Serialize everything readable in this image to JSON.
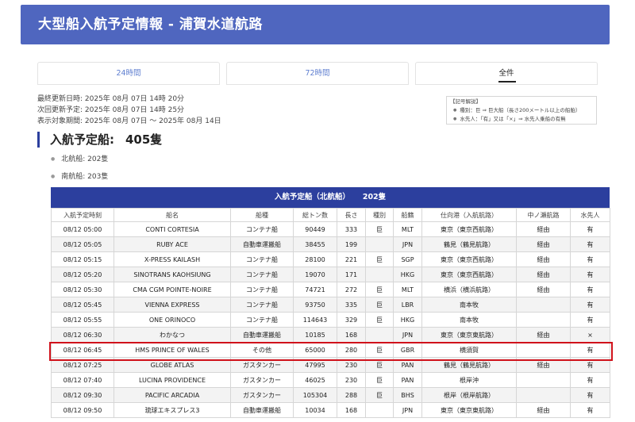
{
  "header": {
    "title": "大型船入航予定情報 - 浦賀水道航路"
  },
  "tabs": [
    {
      "label": "24時間"
    },
    {
      "label": "72時間"
    },
    {
      "label": "全件"
    }
  ],
  "meta": {
    "last_updated": "最終更新日時: 2025年 08月 07日 14時 20分",
    "next_update": "次回更新予定: 2025年 08月 07日 14時 25分",
    "period": "表示対象期間: 2025年 08月 07日 ～ 2025年 08月 14日"
  },
  "legend": {
    "title": "【記号解説】",
    "line1": "種別：巨 ⇒ 巨大船（長さ200メートル以上の船舶）",
    "line2": "水先人：「有」又は「×」⇒ 水先人乗船の有無"
  },
  "section": {
    "title": "入航予定船:",
    "count": "405隻"
  },
  "counts": {
    "north": "北航船: 202隻",
    "south": "南航船: 203隻"
  },
  "table": {
    "title": "入航予定船（北航船）",
    "count": "202隻",
    "headers": [
      "入航予定時刻",
      "船名",
      "船種",
      "総トン数",
      "長さ",
      "種別",
      "船籍",
      "仕向港（入航航路）",
      "中ノ瀬航路",
      "水先人"
    ],
    "rows": [
      [
        "08/12 05:00",
        "CONTI CORTESIA",
        "コンテナ船",
        "90449",
        "333",
        "巨",
        "MLT",
        "東京（東京西航路）",
        "経由",
        "有"
      ],
      [
        "08/12 05:05",
        "RUBY ACE",
        "自動車運搬船",
        "38455",
        "199",
        "",
        "JPN",
        "鶴見（鶴見航路）",
        "経由",
        "有"
      ],
      [
        "08/12 05:15",
        "X-PRESS KAILASH",
        "コンテナ船",
        "28100",
        "221",
        "巨",
        "SGP",
        "東京（東京西航路）",
        "経由",
        "有"
      ],
      [
        "08/12 05:20",
        "SINOTRANS KAOHSIUNG",
        "コンテナ船",
        "19070",
        "171",
        "",
        "HKG",
        "東京（東京西航路）",
        "経由",
        "有"
      ],
      [
        "08/12 05:30",
        "CMA CGM POINTE-NOIRE",
        "コンテナ船",
        "74721",
        "272",
        "巨",
        "MLT",
        "横浜（横浜航路）",
        "経由",
        "有"
      ],
      [
        "08/12 05:45",
        "VIENNA EXPRESS",
        "コンテナ船",
        "93750",
        "335",
        "巨",
        "LBR",
        "南本牧",
        "",
        "有"
      ],
      [
        "08/12 05:55",
        "ONE ORINOCO",
        "コンテナ船",
        "114643",
        "329",
        "巨",
        "HKG",
        "南本牧",
        "",
        "有"
      ],
      [
        "08/12 06:30",
        "わかなつ",
        "自動車運搬船",
        "10185",
        "168",
        "",
        "JPN",
        "東京（東京東航路）",
        "経由",
        "×"
      ],
      [
        "08/12 06:45",
        "HMS PRINCE OF WALES",
        "その他",
        "65000",
        "280",
        "巨",
        "GBR",
        "横須賀",
        "",
        "有"
      ],
      [
        "08/12 07:25",
        "GLOBE ATLAS",
        "ガスタンカー",
        "47995",
        "230",
        "巨",
        "PAN",
        "鶴見（鶴見航路）",
        "経由",
        "有"
      ],
      [
        "08/12 07:40",
        "LUCINA PROVIDENCE",
        "ガスタンカー",
        "46025",
        "230",
        "巨",
        "PAN",
        "根岸沖",
        "",
        "有"
      ],
      [
        "08/12 09:30",
        "PACIFIC ARCADIA",
        "ガスタンカー",
        "105304",
        "288",
        "巨",
        "BHS",
        "根岸（根岸航路）",
        "",
        "有"
      ],
      [
        "08/12 09:50",
        "琉球エキスプレス3",
        "自動車運搬船",
        "10034",
        "168",
        "",
        "JPN",
        "東京（東京東航路）",
        "経由",
        "有"
      ]
    ]
  },
  "colors": {
    "header_bg": "#4f66bf",
    "table_title_bg": "#2c3f9e",
    "highlight": "#d0121b",
    "tab_link": "#5f7fd0"
  }
}
